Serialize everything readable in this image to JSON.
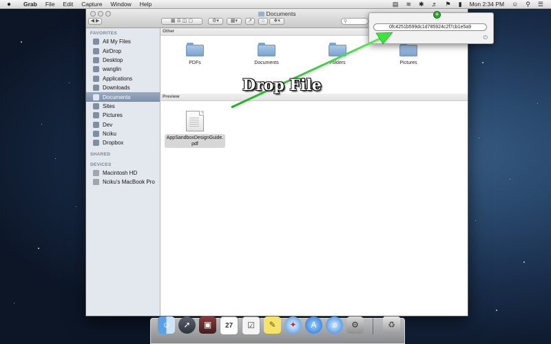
{
  "menubar": {
    "apple_icon": "apple-logo",
    "app_name": "Grab",
    "menus": [
      "File",
      "Edit",
      "Capture",
      "Window",
      "Help"
    ],
    "clock": "Mon 2:34 PM",
    "status_icons": [
      "app-status-icon",
      "wifi-icon",
      "bluetooth-icon",
      "volume-icon",
      "flag-icon",
      "battery-icon",
      "user-icon",
      "search-icon",
      "list-icon"
    ]
  },
  "window": {
    "title": "Documents",
    "sidebar": {
      "favorites_header": "FAVORITES",
      "favorites": [
        "All My Files",
        "AirDrop",
        "Desktop",
        "wanglin",
        "Applications",
        "Downloads",
        "Documents",
        "Sites",
        "Pictures",
        "Dev",
        "Nciku",
        "Dropbox"
      ],
      "selected": "Documents",
      "shared_header": "SHARED",
      "devices_header": "DEVICES",
      "devices": [
        "Macintosh HD",
        "Nciku's MacBook Pro"
      ]
    },
    "groups": [
      {
        "header": "Other",
        "items": [
          "PDFs",
          "Documents",
          "Folders",
          "Pictures"
        ]
      },
      {
        "header": "Preview",
        "items": [
          "AppSandboxDesignGuide.pdf"
        ]
      }
    ],
    "preview_label_line1": "AppSandboxDesignGuide.",
    "preview_label_line2": "pdf"
  },
  "popover": {
    "hash_value": "0fc4251b599dc1d785924c2f7cb1e5a9",
    "power_icon": "power-icon",
    "add_badge": "+"
  },
  "caption": "Drop File",
  "colors": {
    "arrow": "#2fd12f",
    "selection": "#7d90ab",
    "folder": "#8fb3d9"
  },
  "dock": {
    "apps": [
      "finder-icon",
      "launchpad-icon",
      "photo-booth-icon",
      "calendar-icon",
      "reminders-icon",
      "stickies-icon",
      "safari-icon",
      "app-store-icon",
      "itunes-icon",
      "system-preferences-icon"
    ],
    "calendar_day": "27",
    "trash": "trash-icon"
  }
}
